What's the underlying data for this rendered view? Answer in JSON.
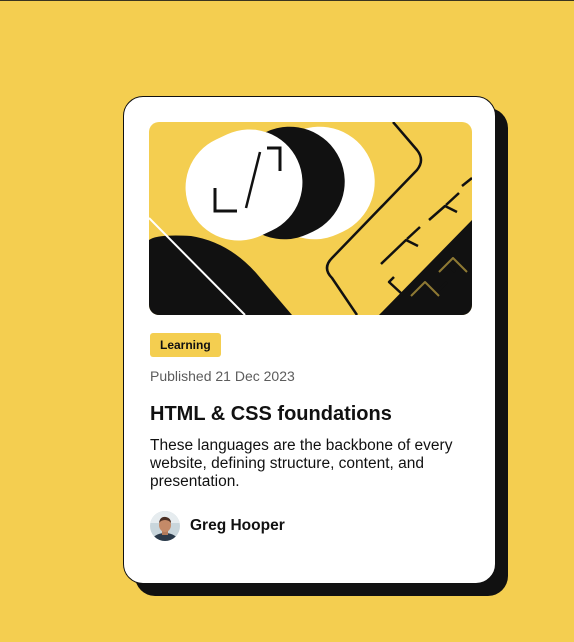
{
  "card": {
    "tag_label": "Learning",
    "published": "Published 21 Dec 2023",
    "title": "HTML & CSS foundations",
    "excerpt": "These languages are the backbone of every website, defining structure, content, and presentation.",
    "author_name": "Greg Hooper"
  },
  "colors": {
    "background": "#F4CE50",
    "card": "#FFFFFF",
    "ink": "#111111",
    "muted_text": "#5C5C5C"
  },
  "icons": {
    "illustration": "abstract-geometric-illustration",
    "avatar": "author-avatar"
  }
}
